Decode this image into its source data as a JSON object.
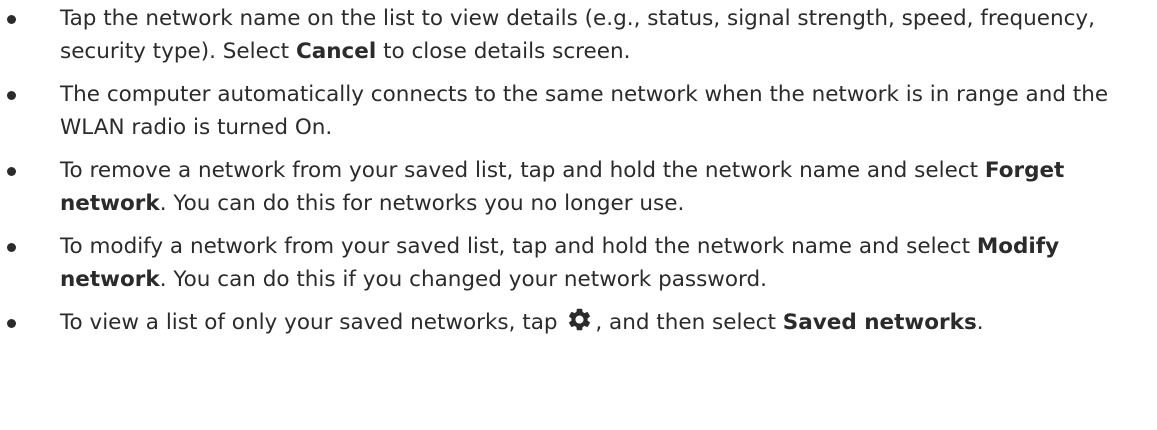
{
  "bullets": [
    {
      "text_before": "Tap the network name on the list to view details (e.g., status, signal strength, speed, frequency, security type). Select ",
      "bold": "Cancel",
      "text_after": " to close details screen."
    },
    {
      "text": "The computer automatically connects to the same network when the network is in range and the WLAN radio is turned On."
    },
    {
      "text_before": "To remove a network from your saved list, tap and hold the network name and select ",
      "bold": "Forget network",
      "text_after": ". You can do this for networks you no longer use."
    },
    {
      "text_before": "To modify a network from your saved list, tap and hold the network name and select ",
      "bold": "Modify network",
      "text_after": ". You can do this if you changed your network password."
    },
    {
      "text_before": "To view a list of only your saved networks, tap ",
      "icon": "gear-icon",
      "text_middle": ", and then select ",
      "bold": "Saved networks",
      "text_after": "."
    }
  ]
}
